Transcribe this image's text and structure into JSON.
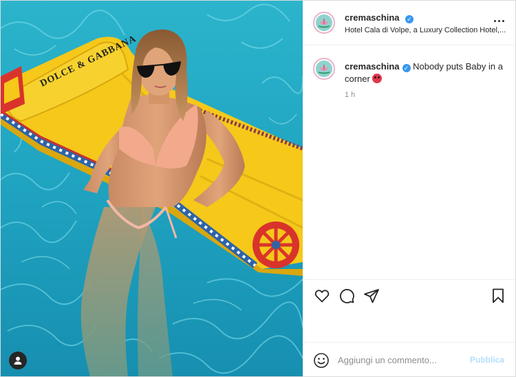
{
  "post": {
    "username": "cremaschina",
    "verified": true,
    "location": "Hotel Cala di Volpe, a Luxury Collection Hotel,...",
    "more_label": "...",
    "caption": "Nobody puts Baby in a corner",
    "caption_emoji": "devil-emoji",
    "time_ago": "1 h"
  },
  "actions": {
    "like_icon": "heart-icon",
    "comment_icon": "comment-icon",
    "share_icon": "paper-plane-icon",
    "save_icon": "bookmark-icon"
  },
  "comment_bar": {
    "placeholder": "Aggiungi un commento...",
    "publish_label": "Pubblica",
    "emoji_icon": "smiley-icon"
  },
  "photo": {
    "tag_icon": "user-tag-icon",
    "brand_text": "DOLCE & GABBANA"
  },
  "colors": {
    "accent_link": "#b2dffc",
    "verified_blue": "#3897f0",
    "pool_water": "#1fa6c2",
    "float_yellow": "#f5c81a"
  }
}
